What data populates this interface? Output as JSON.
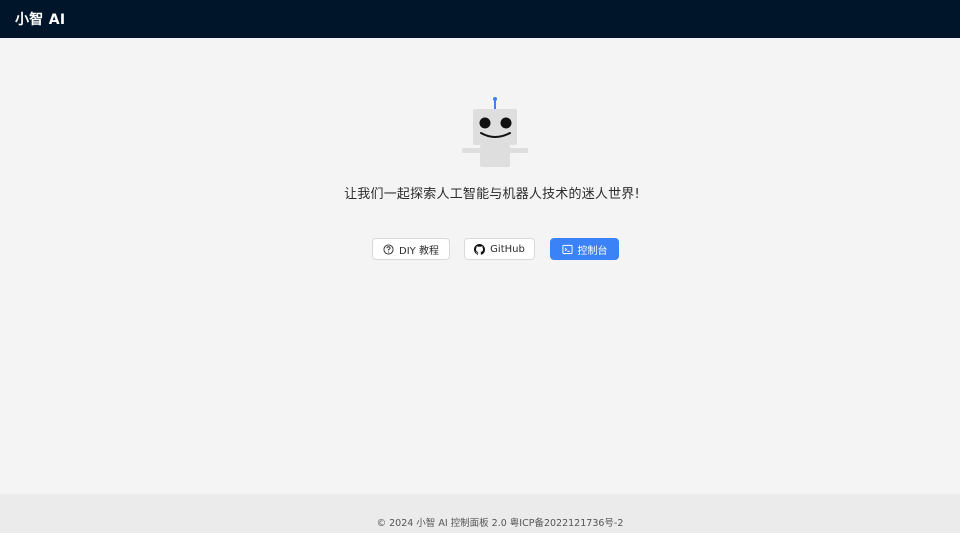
{
  "header": {
    "title": "小智 AI"
  },
  "main": {
    "robot_icon": "robot-mascot-icon",
    "tagline": "让我们一起探索人工智能与机器人技术的迷人世界!",
    "buttons": {
      "diy_label": "DIY 教程",
      "diy_icon": "question-circle-icon",
      "github_label": "GitHub",
      "github_icon": "github-icon",
      "console_label": "控制台",
      "console_icon": "terminal-icon"
    }
  },
  "footer": {
    "copyright": "© 2024 小智 AI 控制面板 2.0 粤ICP备2022121736号-2"
  },
  "colors": {
    "header_bg": "#001529",
    "primary": "#3b82f6",
    "page_bg": "#f4f4f4",
    "footer_bg": "#ebebeb"
  }
}
